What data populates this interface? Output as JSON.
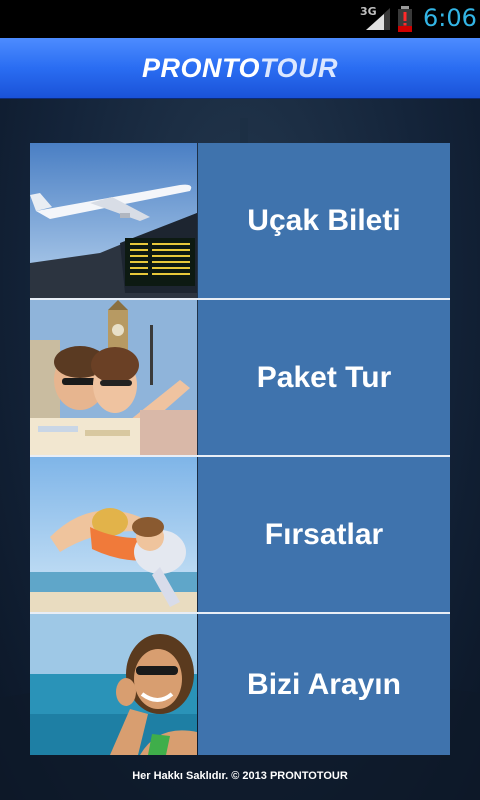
{
  "status_bar": {
    "network": "3G",
    "time": "6:06",
    "icons": [
      "signal-icon",
      "battery-alert-icon"
    ],
    "clock_color": "#33b5e5"
  },
  "header": {
    "logo_prefix": "PRONTO",
    "logo_suffix": "TOUR",
    "color": "#2a6df2"
  },
  "menu": {
    "items": [
      {
        "label": "Uçak Bileti",
        "image": "airplane-airport-photo"
      },
      {
        "label": "Paket Tur",
        "image": "couple-big-ben-photo"
      },
      {
        "label": "Fırsatlar",
        "image": "family-beach-photo"
      },
      {
        "label": "Bizi Arayın",
        "image": "woman-phone-gesture-photo"
      }
    ],
    "tile_color": "#3f73ad"
  },
  "footer": {
    "text": "Her Hakkı Saklıdır.  © 2013  PRONTOTOUR"
  }
}
